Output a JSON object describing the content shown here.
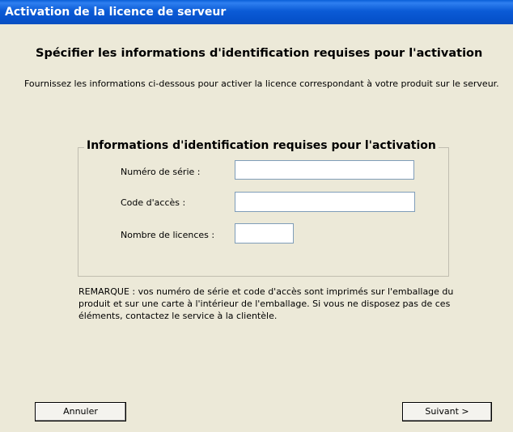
{
  "window": {
    "title": "Activation de la licence de serveur"
  },
  "page": {
    "heading": "Spécifier les informations d'identification requises pour l'activation",
    "intro": "Fournissez les informations ci-dessous pour activer la licence correspondant à votre produit sur le serveur."
  },
  "group": {
    "legend": "Informations d'identification requises pour l'activation",
    "fields": {
      "serial": {
        "label": "Numéro de série :",
        "value": ""
      },
      "access_code": {
        "label": "Code d'accès :",
        "value": ""
      },
      "license_count": {
        "label": "Nombre de licences :",
        "value": ""
      }
    }
  },
  "note": "REMARQUE : vos numéro de série et code d'accès sont imprimés sur l'emballage du produit et sur une carte à l'intérieur de l'emballage.  Si vous ne disposez pas de ces éléments, contactez le service à la clientèle.",
  "buttons": {
    "cancel": "Annuler",
    "next": "Suivant >"
  },
  "colors": {
    "titlebar": "#0a5fd8",
    "window_background": "#ece9d8",
    "input_border": "#7f9db9"
  }
}
